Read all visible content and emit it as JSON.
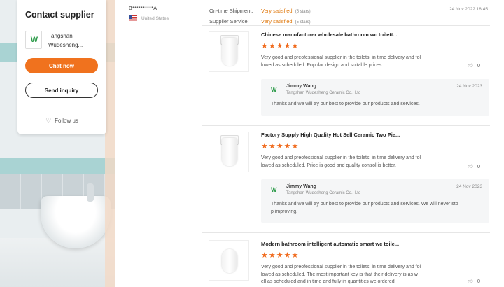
{
  "sidebar": {
    "title": "Contact supplier",
    "company_line1": "Tangshan",
    "company_line2": "Wudesheng...",
    "chat_label": "Chat now",
    "inquiry_label": "Send inquiry",
    "follow_label": "Follow us"
  },
  "buyer": {
    "name": "B**********A",
    "country": "United States"
  },
  "ratings": {
    "shipment_label": "On-time Shipment:",
    "shipment_value": "Very satisfied",
    "shipment_stars": "(5 stars)",
    "service_label": "Supplier Service:",
    "service_value": "Very satisfied",
    "service_stars": "(5 stars)",
    "date": "24 Nov 2022 18:45"
  },
  "reviews": [
    {
      "title": "Chinese manufacturer wholesale bathroom wc toilett...",
      "stars": "★★★★★",
      "text_line1": "Very good and preofessional supplier in the toilets, in time delivery and fol",
      "text_line2": "lowed as scheduled.  Popular design and suitable prices.",
      "likes": "0",
      "reply": {
        "name": "Jimmy Wang",
        "company": "Tangshan Wudesheng Ceramic Co., Ltd",
        "date": "24 Nov 2023",
        "text_line1": "Thanks and we will try our best to provide our products and services.",
        "text_line2": ""
      }
    },
    {
      "title": "Factory Supply High Quality Hot Sell Ceramic Two Pie...",
      "stars": "★★★★★",
      "text_line1": "Very good and preofessional supplier in the toilets, in time delivery and fol",
      "text_line2": "lowed as scheduled.  Price is good and quality control is better.",
      "likes": "0",
      "reply": {
        "name": "Jimmy Wang",
        "company": "Tangshan Wudesheng Ceramic Co., Ltd",
        "date": "24 Nov 2023",
        "text_line1": "Thanks and we will try our best to provide our products and services. We will never sto",
        "text_line2": "p improving."
      }
    },
    {
      "title": "Modern bathroom intelligent automatic smart wc toile...",
      "stars": "★★★★★",
      "text_line1": "Very good and preofessional supplier in the toilets, in time delivery and fol",
      "text_line2": "lowed as scheduled.  The most important key is that their delivery is as w",
      "text_line3": "ell as scheduled and in time and fully in quantities we ordered.",
      "likes": "0"
    }
  ],
  "colors": {
    "accent": "#f0721e",
    "star": "#f06a1c",
    "satisfied": "#e07a10"
  }
}
